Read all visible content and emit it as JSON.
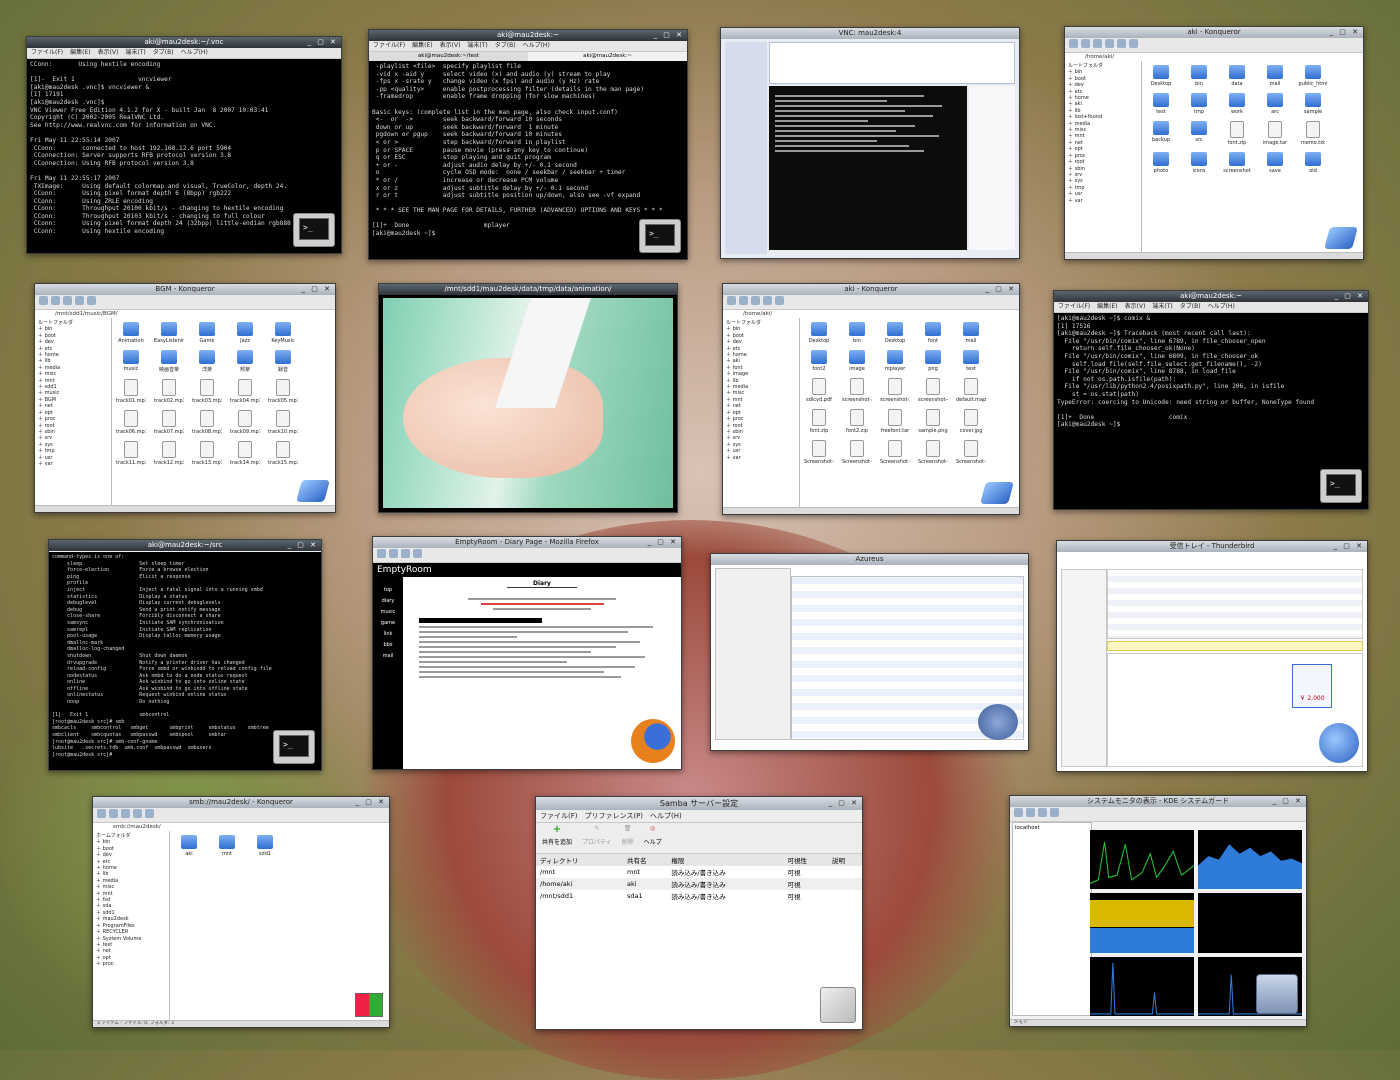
{
  "windows": {
    "vnc_term": {
      "title": "aki@mau2desk:~/.vnc",
      "menu": [
        "ファイル(F)",
        "編集(E)",
        "表示(V)",
        "端末(T)",
        "タブ(B)",
        "ヘルプ(H)"
      ],
      "lines": [
        "CConn:       Using hextile encoding",
        "",
        "[1]-  Exit 1                 vncviewer",
        "[aki@mau2desk .vnc]$ vncviewer &",
        "[1] 17191",
        "[aki@mau2desk .vnc]$",
        "VNC Viewer Free Edition 4.1.2 for X - built Jan  8 2007 10:03:41",
        "Copyright (C) 2002-2005 RealVNC Ltd.",
        "See http://www.realvnc.com for information on VNC.",
        "",
        "Fri May 11 22:55:14 2007",
        " CConn:       connected to host 192.168.12.6 port 5904",
        " CConnection: Server supports RFB protocol version 3.8",
        " CConnection: Using RFB protocol version 3.8",
        "",
        "Fri May 11 22:55:17 2007",
        " TXImage:     Using default colormap and visual, TrueColor, depth 24.",
        " CConn:       Using pixel format depth 6 (8bpp) rgb222",
        " CConn:       Using ZRLE encoding",
        " CConn:       Throughput 20100 kbit/s - changing to hextile encoding",
        " CConn:       Throughput 20103 kbit/s - changing to full colour",
        " CConn:       Using pixel format depth 24 (32bpp) little-endian rgb888",
        " CConn:       Using hextile encoding"
      ]
    },
    "mplayer_term": {
      "title": "aki@mau2desk:~",
      "menu": [
        "ファイル(F)",
        "編集(E)",
        "表示(V)",
        "端末(T)",
        "タブ(B)",
        "ヘルプ(H)"
      ],
      "tabs": [
        "aki@mau2desk:~/test",
        "aki@mau2desk:~"
      ],
      "lines": [
        " -playlist <file>  specify playlist file",
        " -vid x -aid y     select video (x) and audio (y) stream to play",
        " -fps x -srate y   change video (x fps) and audio (y Hz) rate",
        " -pp <quality>     enable postprocessing filter (details in the man page)",
        " -framedrop        enable frame dropping (for slow machines)",
        "",
        "Basic keys: (complete list in the man page, also check input.conf)",
        " <-  or  ->        seek backward/forward 10 seconds",
        " down or up        seek backward/forward  1 minute",
        " pgdown or pgup    seek backward/forward 10 minutes",
        " < or >            step backward/forward in playlist",
        " p or SPACE        pause movie (press any key to continue)",
        " q or ESC          stop playing and quit program",
        " + or -            adjust audio delay by +/- 0.1 second",
        " o                 cycle OSD mode:  none / seekbar / seekbar + timer",
        " * or /            increase or decrease PCM volume",
        " x or z            adjust subtitle delay by +/- 0.1 second",
        " r or t            adjust subtitle position up/down, also see -vf expand",
        "",
        " * * * SEE THE MAN PAGE FOR DETAILS, FURTHER (ADVANCED) OPTIONS AND KEYS * * *",
        "",
        "[1]+  Done                    mplayer",
        "[aki@mau2desk ~]$ "
      ]
    },
    "vnc_viewer": {
      "title": "VNC: mau2desk:4"
    },
    "konq_home": {
      "title": "aki - Konqueror",
      "address": "/home/aki/",
      "tree": [
        "ルートフォルダ",
        "bin",
        "boot",
        "dev",
        "etc",
        "home",
        "aki",
        "lib",
        "lost+found",
        "media",
        "misc",
        "mnt",
        "net",
        "opt",
        "proc",
        "root",
        "sbin",
        "srv",
        "sys",
        "tmp",
        "usr",
        "var"
      ],
      "files": [
        "Desktop",
        "bin",
        "data",
        "mail",
        "public_html",
        "test",
        "tmp",
        "work",
        "arc",
        "sample",
        "backup",
        "src",
        "font.zip",
        "image.tar",
        "memo.txt",
        "photo",
        "icons",
        "screenshot",
        "save",
        "old"
      ]
    },
    "konq_bgm": {
      "title": "BGM - Konqueror",
      "address": "/mnt/sdd1/music/BGM/",
      "tree": [
        "ルートフォルダ",
        "bin",
        "boot",
        "dev",
        "etc",
        "home",
        "lib",
        "media",
        "misc",
        "mnt",
        "sdd1",
        "music",
        "BGM",
        "net",
        "opt",
        "proc",
        "root",
        "sbin",
        "srv",
        "sys",
        "tmp",
        "usr",
        "var"
      ],
      "files": [
        "Animation",
        "EasyListening",
        "Game",
        "Jazz",
        "KeyMusic",
        "music",
        "映画音楽",
        "洋楽",
        "邦楽",
        "録音",
        "track01.mp3",
        "track02.mp3",
        "track03.mp3",
        "track04.mp3",
        "track05.mp3",
        "track06.mp3",
        "track07.mp3",
        "track08.mp3",
        "track09.mp3",
        "track10.mp3",
        "track11.mp3",
        "track12.mp3",
        "track13.mp3",
        "track14.mp3",
        "track15.mp3"
      ]
    },
    "mplayer_video": {
      "title": "/mnt/sdd1/mau2desk/data/tmp/data/animation/"
    },
    "konq_aki": {
      "title": "aki - Konqueror",
      "address": "/home/aki/",
      "tree": [
        "ルートフォルダ",
        "bin",
        "boot",
        "dev",
        "etc",
        "home",
        "aki",
        "font",
        "image",
        "lib",
        "media",
        "misc",
        "mnt",
        "net",
        "opt",
        "proc",
        "root",
        "sbin",
        "srv",
        "sys",
        "usr",
        "var"
      ],
      "files": [
        "Desktop",
        "bin",
        "Desktop",
        "font",
        "mail",
        "font2",
        "image",
        "mplayer",
        "png",
        "test",
        "sdlcvd.pdf",
        "screenshot-2.png",
        "screenshot-3.png",
        "screenshot-4.png",
        "default.map",
        "font.zip",
        "font2.zip",
        "freefont.tar",
        "sample.png",
        "cover.jpg",
        "Screenshot-1.png",
        "Screenshot-2.png",
        "Screenshot-3.png",
        "Screenshot-4.png",
        "Screenshot-5.png"
      ]
    },
    "comix_term": {
      "title": "aki@mau2desk:~",
      "menu": [
        "ファイル(F)",
        "編集(E)",
        "表示(V)",
        "端末(T)",
        "タブ(B)",
        "ヘルプ(H)"
      ],
      "lines": [
        "[aki@mau2desk ~]$ comix &",
        "[1] 17516",
        "[aki@mau2desk ~]$ Traceback (most recent call last):",
        "  File \"/usr/bin/comix\", line 6789, in file_chooser_open",
        "    return self.file_chooser_ok(None)",
        "  File \"/usr/bin/comix\", line 6809, in file_chooser_ok",
        "    self.load_file(self.file_select.get_filename(), -2)",
        "  File \"/usr/bin/comix\", line 8788, in load_file",
        "    if not os.path.isfile(path):",
        "  File \"/usr/lib/python2.4/posixpath.py\", line 206, in isfile",
        "    st = os.stat(path)",
        "TypeError: coercing to Unicode: need string or buffer, NoneType found",
        "",
        "[1]+  Done                    comix",
        "[aki@mau2desk ~]$ "
      ]
    },
    "rabbit_term": {
      "title": "aki@mau2desk:~/src",
      "lines": [
        "command-types is one of:",
        "     sleep                   Set sleep timer",
        "     force-election          Force a browse election",
        "     ping                    Elicit a response",
        "     profile                 ",
        "     inject                  Inject a fatal signal into a running smbd",
        "     statistics              Display a status",
        "     debuglevel              Display current debuglevels",
        "     debug                   Send a print notify message",
        "     close-share             Forcibly disconnect a share",
        "     samsync                 Initiate SAM synchronisation",
        "     samrepl                 Initiate SAM replication",
        "     pool-usage              Display talloc memory usage",
        "     dmalloc-mark            ",
        "     dmalloc-log-changed     ",
        "     shutdown                Shut down daemon",
        "     drvupgrade              Notify a printer driver has changed",
        "     reload-config           Force smbd or winbindd to reload config file",
        "     nodestatus              Ask nmbd to do a node status request",
        "     online                  Ask winbind to go into online state",
        "     offline                 Ask winbind to go into offline state",
        "     onlinestatus            Request winbind online status",
        "     noop                    Do nothing",
        "",
        "[1]-  Exit 1                 smbcontrol",
        "[root@mau2desk src]# smb",
        "smbcacls     smbcontrol   smbget       smbprint     smbstatus    smbtree",
        "smbclient    smbcquotas   smbpasswd    smbspool     smbtar",
        "[root@mau2desk src]# smb-conf-gnome",
        "lubsite   .secrets.tdb  smb.conf  smbpasswd  smbusers",
        "[root@mau2desk src]# "
      ]
    },
    "firefox": {
      "title": "EmptyRoom - Diary Page - Mozilla Firefox",
      "site_title": "EmptyRoom",
      "heading": "Diary",
      "nav": [
        "top",
        "diary",
        "music",
        "game",
        "link",
        "bbs",
        "mail"
      ]
    },
    "azureus": {
      "title": "Azureus"
    },
    "thunderbird": {
      "title": "受信トレイ - Thunderbird",
      "price": "￥ 2,000"
    },
    "konq_smb": {
      "title": "smb://mau2desk/ - Konqueror",
      "address": "smb://mau2desk/",
      "tree": [
        "ホームフォルダ",
        "bin",
        "boot",
        "dev",
        "etc",
        "home",
        "lib",
        "media",
        "misc",
        "mnt",
        "fsd",
        "sda",
        "sdd1",
        "mau2desk",
        "ProgramFiles",
        "RECYCLER",
        "System Volume",
        "test",
        "net",
        "opt",
        "proc"
      ],
      "files": [
        "aki",
        "mnt",
        "sdd1"
      ],
      "status": "3 アイテム - ファイル: 0, フォルダ: 3"
    },
    "samba": {
      "title": "Samba サーバー設定",
      "menu": [
        "ファイル(F)",
        "プリファレンス(P)",
        "ヘルプ(H)"
      ],
      "toolbar": [
        "共有を追加",
        "プロパティ",
        "削除",
        "ヘルプ"
      ],
      "columns": [
        "ディレクトリ",
        "共有名",
        "権限",
        "可視性",
        "説明"
      ],
      "rows": [
        [
          "/mnt",
          "mnt",
          "読み込み/書き込み",
          "可視",
          ""
        ],
        [
          "/home/aki",
          "aki",
          "読み込み/書き込み",
          "可視",
          ""
        ],
        [
          "/mnt/sdd1",
          "sda1",
          "読み込み/書き込み",
          "可視",
          ""
        ]
      ]
    },
    "ksysguard": {
      "title": "システムモニタの表示 - KDE システムガード",
      "tree_root": "localhost",
      "status": "メモリ"
    }
  },
  "colors": {
    "graph_green": "#23c23a",
    "graph_blue": "#2f7bd9",
    "graph_yellow": "#d8b800"
  }
}
